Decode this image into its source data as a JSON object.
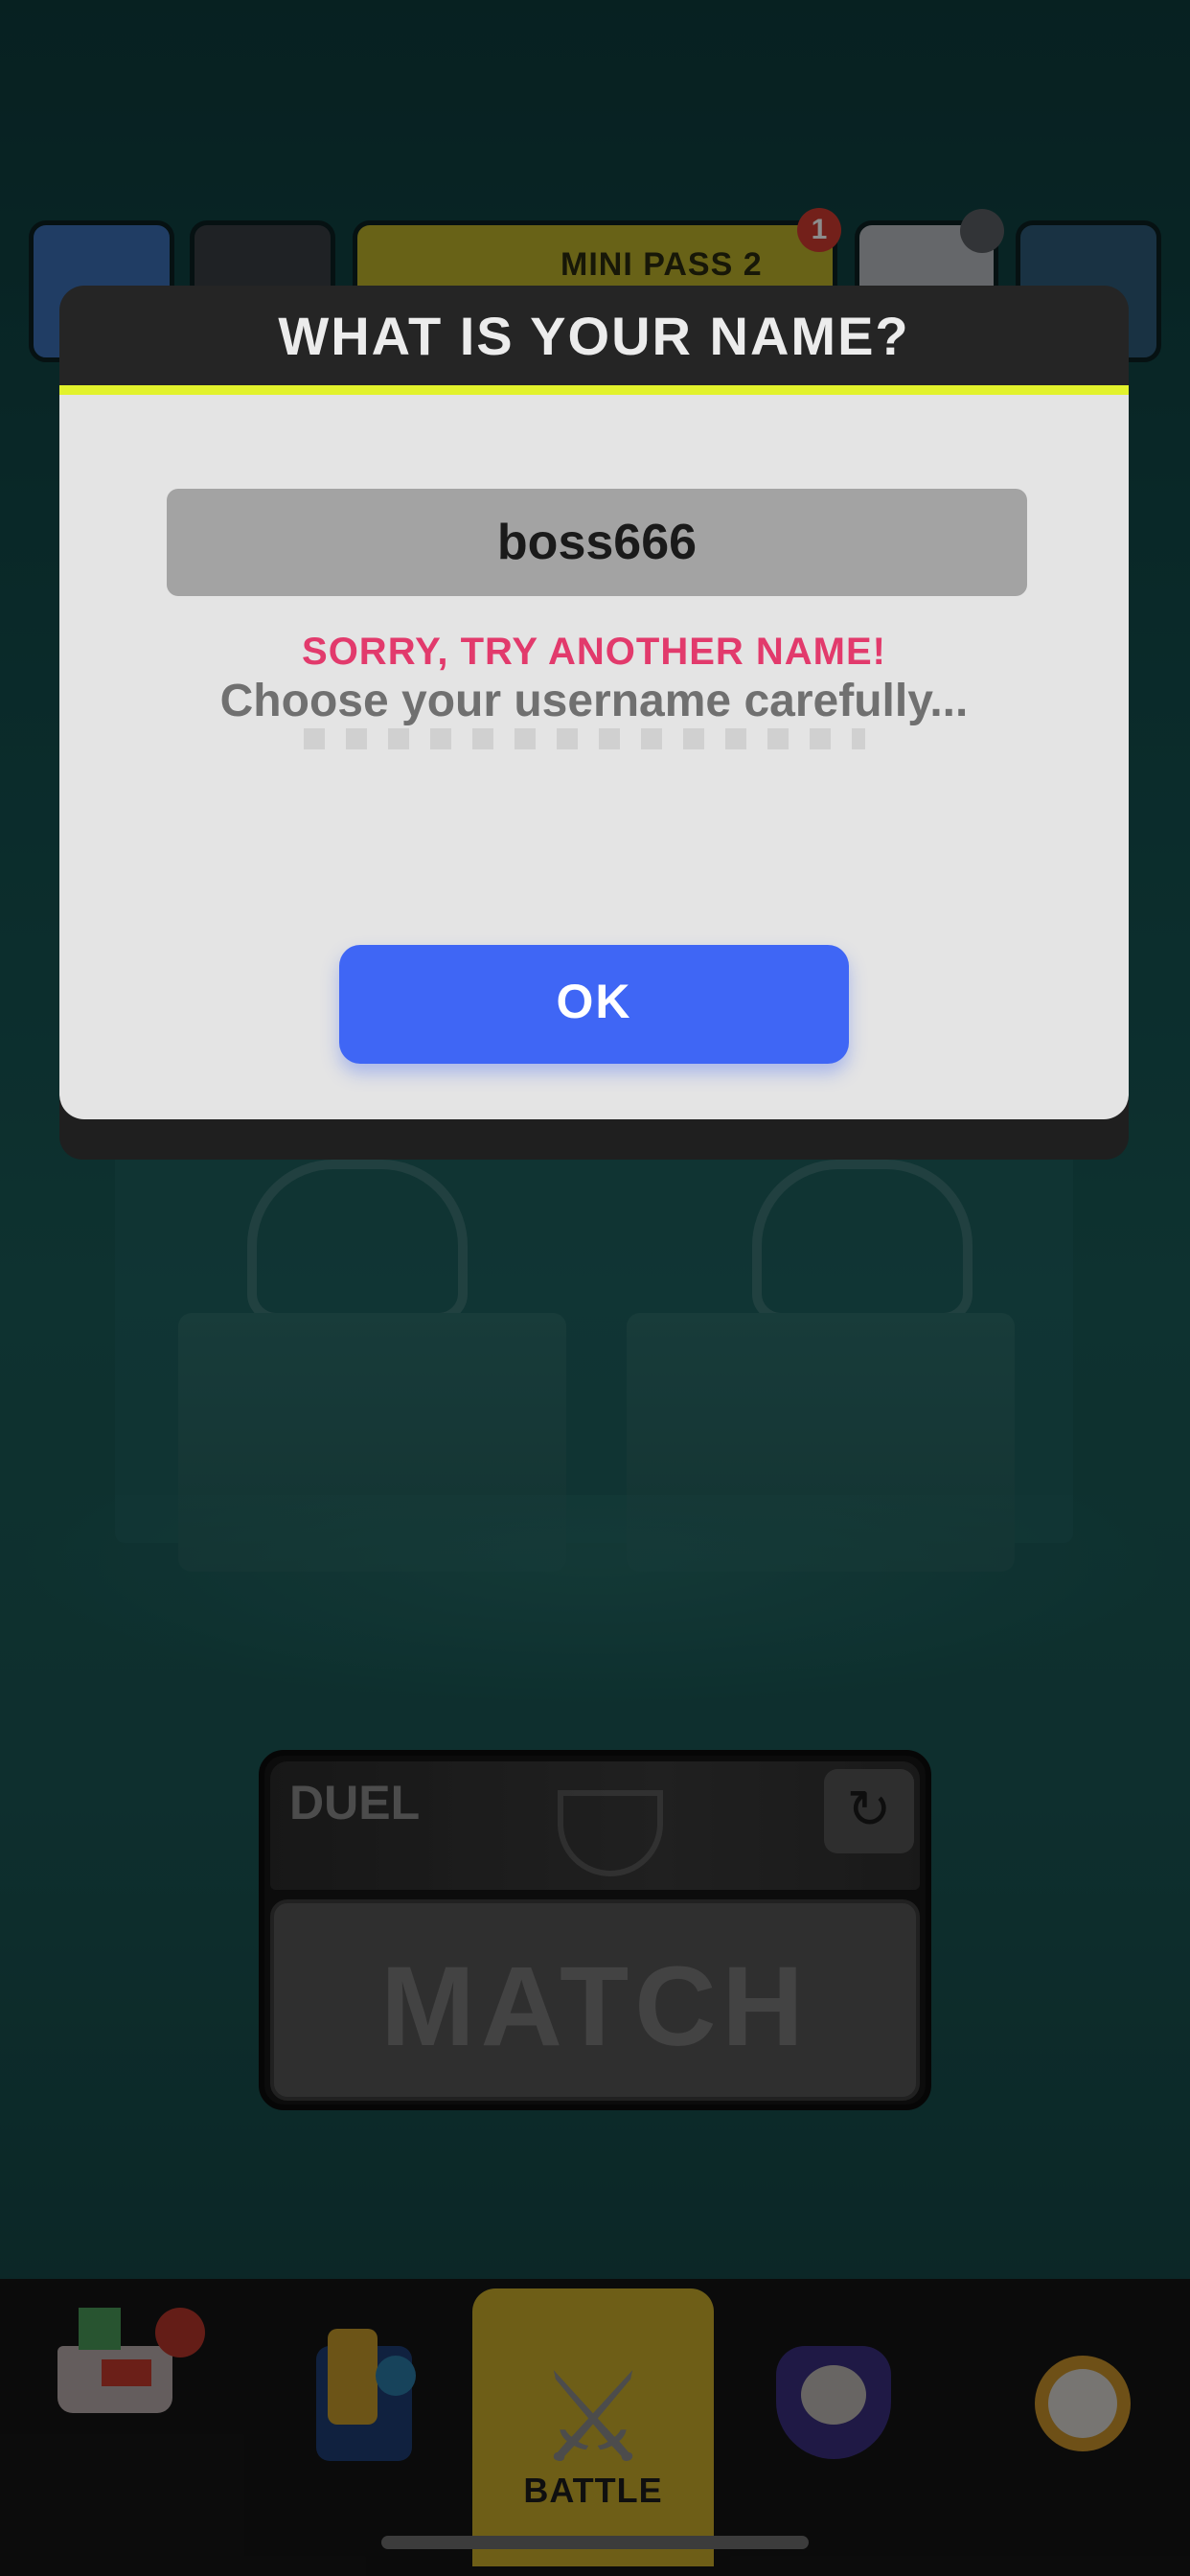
{
  "topbar": {
    "pass_label": "MINI PASS 2",
    "pass_badge_count": "1"
  },
  "mode": {
    "duel_label": "DUEL",
    "refresh_icon": "refresh-icon",
    "match_label": "MATCH"
  },
  "nav": {
    "battle_label": "BATTLE",
    "active_tab": "battle",
    "battle_color": "#c8ac2b"
  },
  "dialog": {
    "title": "WHAT IS YOUR NAME?",
    "name_value": "boss666",
    "error": "SORRY, TRY ANOTHER NAME!",
    "hint": "Choose your username carefully...",
    "ok_label": "OK",
    "accent_color": "#e2f22c",
    "button_color": "#3f66f5",
    "error_color": "#e23a6c"
  }
}
